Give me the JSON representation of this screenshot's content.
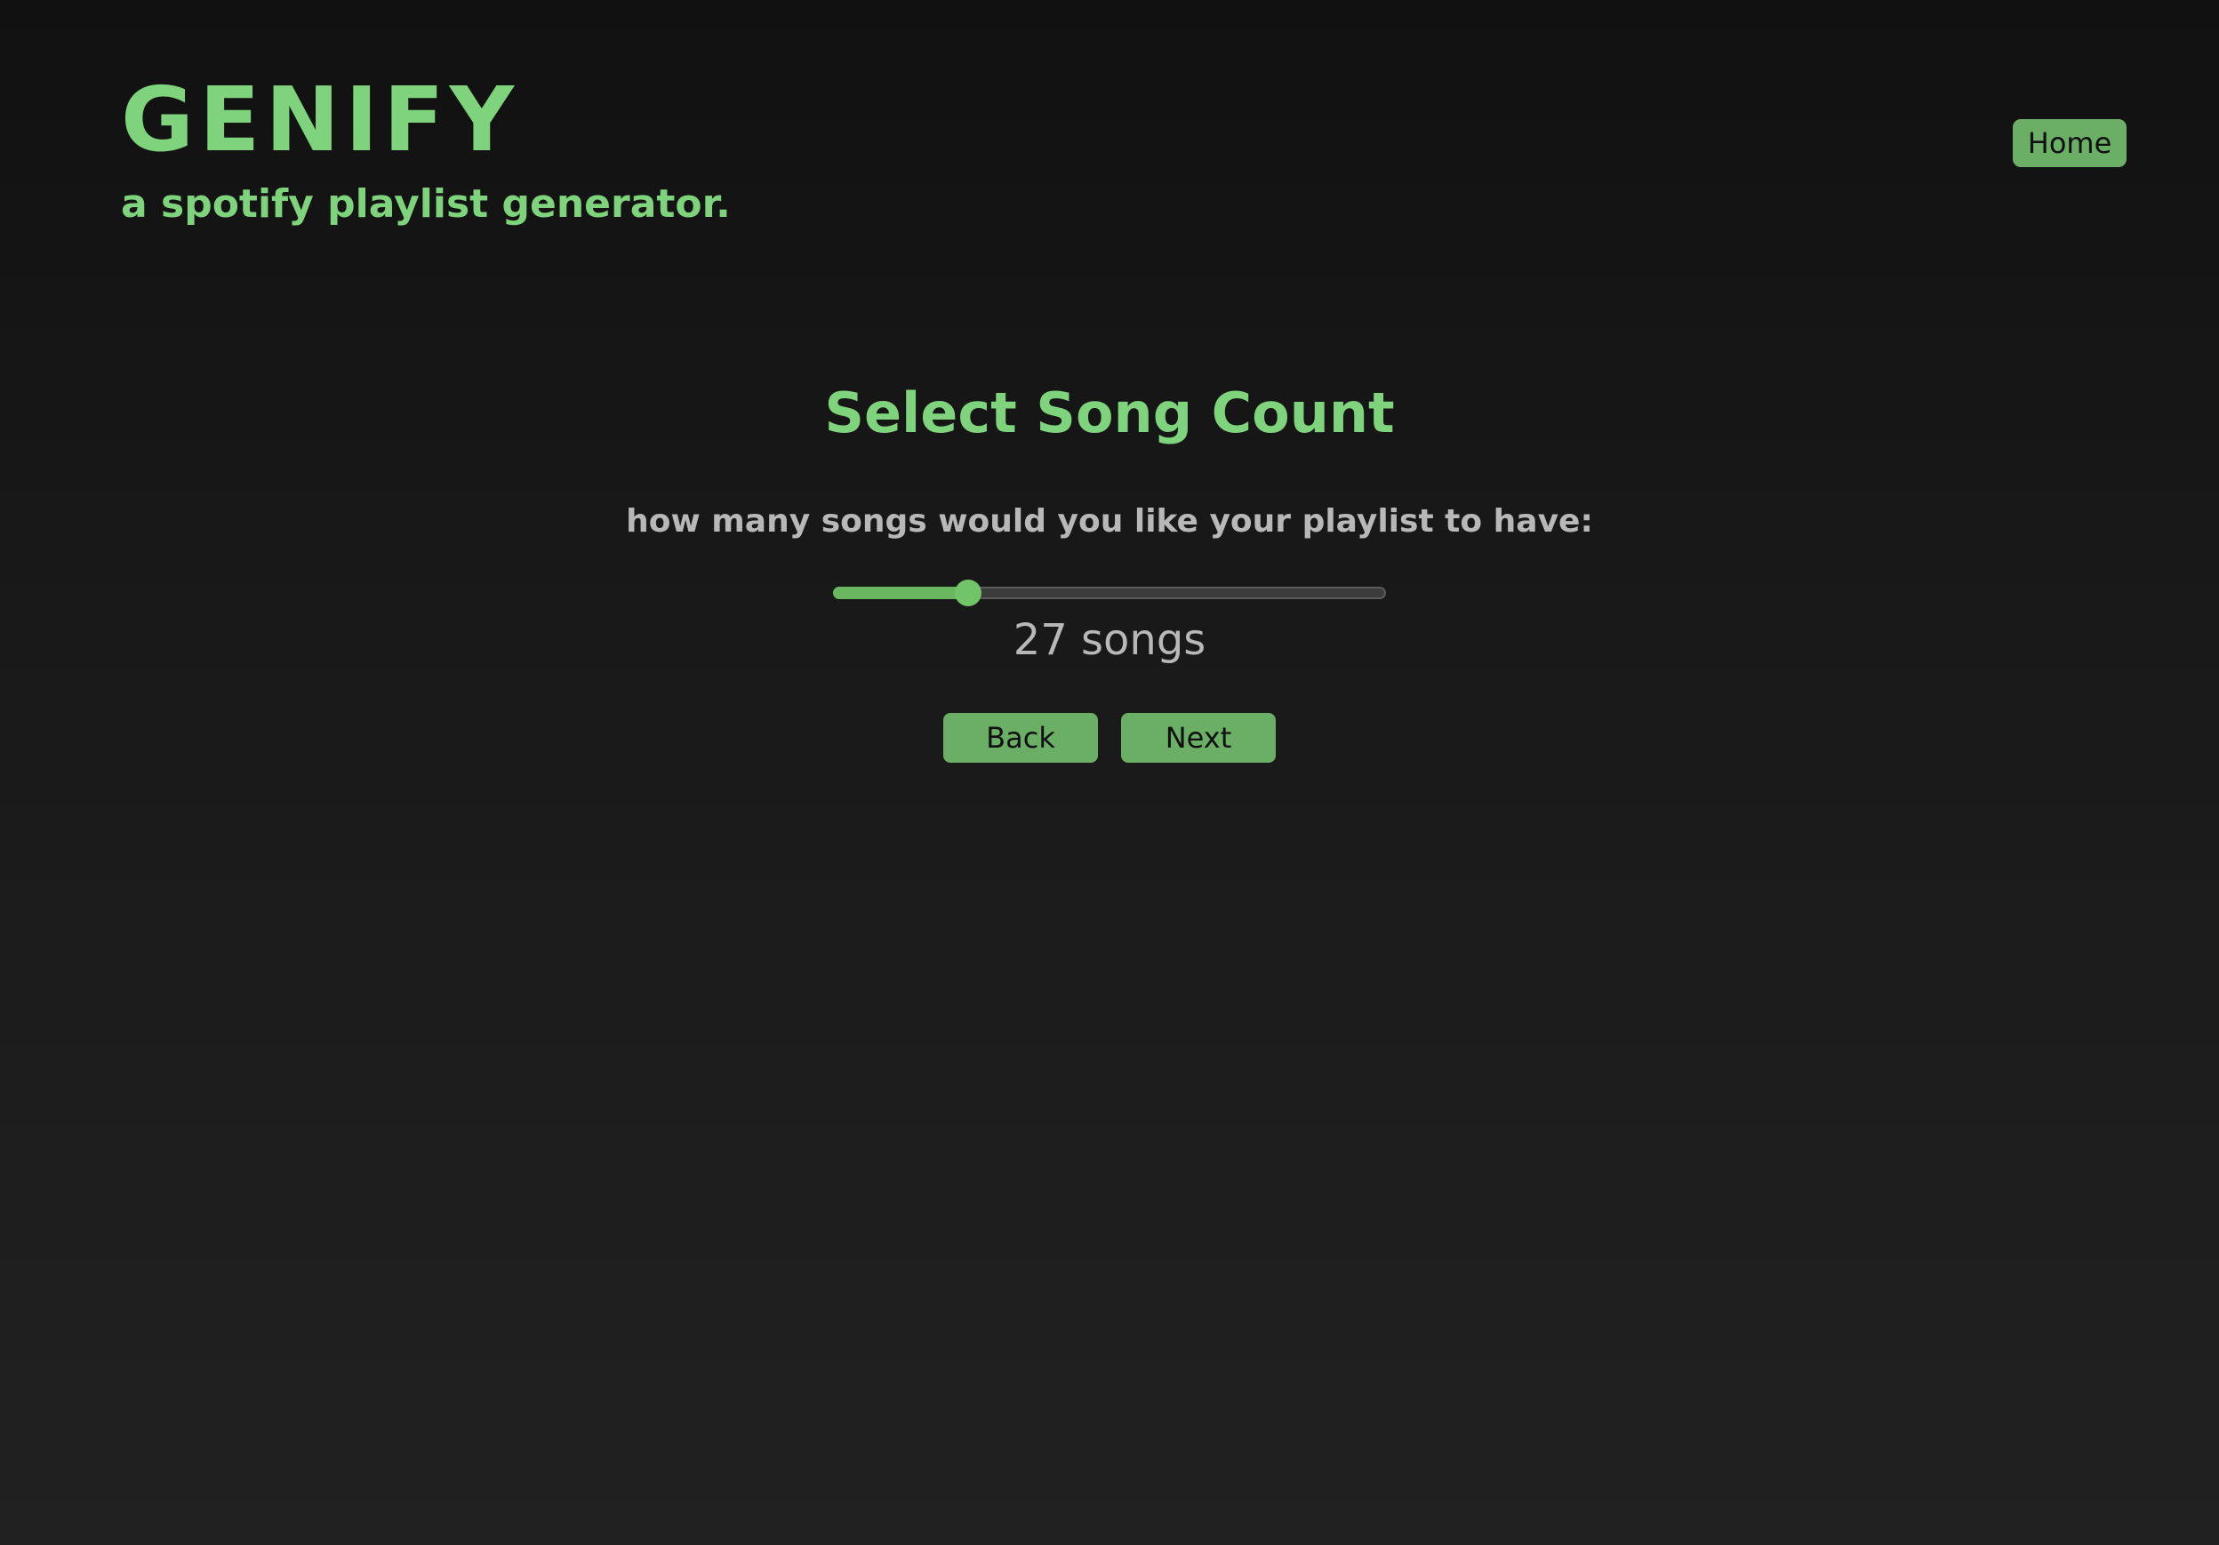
{
  "header": {
    "app_title": "GENIFY",
    "app_subtitle": "a spotify playlist generator.",
    "home_label": "Home"
  },
  "main": {
    "title": "Select Song Count",
    "prompt": "how many songs would you like your playlist to have:",
    "slider": {
      "fraction": 0.245
    },
    "count_readout": "27 songs",
    "back_label": "Back",
    "next_label": "Next"
  },
  "colors": {
    "accent": "#7ed37c",
    "button": "#6bae65",
    "text_muted": "#b8b8b8",
    "background": "#1a1a1a"
  }
}
